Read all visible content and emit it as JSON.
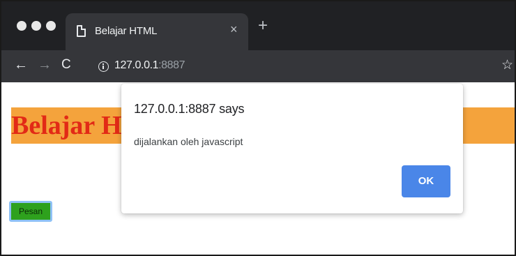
{
  "browser": {
    "tab": {
      "title": "Belajar HTML",
      "close_glyph": "×"
    },
    "new_tab_glyph": "+",
    "nav": {
      "back_glyph": "←",
      "forward_glyph": "→",
      "reload_glyph": "C"
    },
    "address": {
      "host": "127.0.0.1",
      "port": ":8887"
    },
    "bookmark_glyph": "☆"
  },
  "page": {
    "heading": "Belajar HTML",
    "heading_color": "#e22a16",
    "heading_bg": "#f4a33c",
    "button_label": "Pesan",
    "button_bg": "#2ea11d"
  },
  "dialog": {
    "title": "127.0.0.1:8887 says",
    "message": "dijalankan oleh javascript",
    "ok_label": "OK",
    "ok_color": "#4a86e8"
  }
}
